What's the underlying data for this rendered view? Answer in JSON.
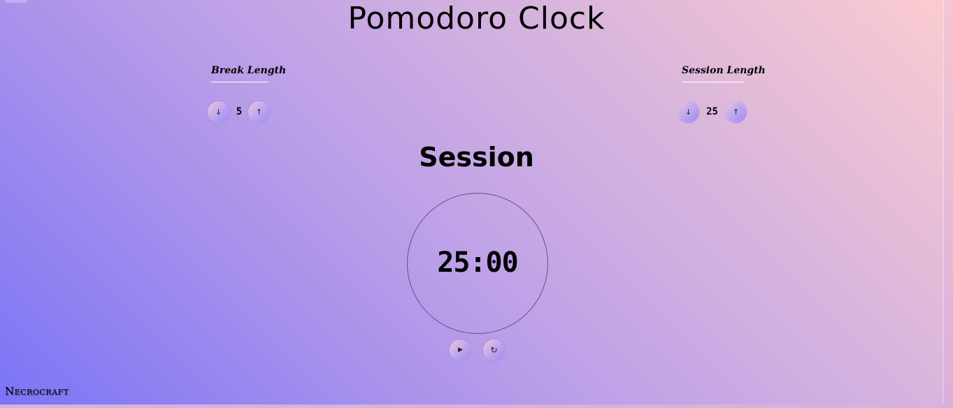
{
  "app": {
    "title": "Pomodoro Clock",
    "brand": "Necrocraft"
  },
  "break": {
    "label": "Break Length",
    "value": "5",
    "decrement_glyph": "↓",
    "increment_glyph": "↑"
  },
  "session": {
    "label": "Session Length",
    "value": "25",
    "decrement_glyph": "↓",
    "increment_glyph": "↑"
  },
  "timer": {
    "label": "Session",
    "time_left": "25:00",
    "start_stop_glyph": "▶",
    "reset_glyph": "↻"
  },
  "icons": {
    "break_decrement": "arrow-down-icon",
    "break_increment": "arrow-up-icon",
    "session_decrement": "arrow-down-icon",
    "session_increment": "arrow-up-icon",
    "start_stop": "play-icon",
    "reset": "refresh-icon"
  },
  "colors": {
    "gradient_start": "#7b74f6",
    "gradient_end": "#fbcbd0",
    "dial_border": "#6e4c7c"
  }
}
